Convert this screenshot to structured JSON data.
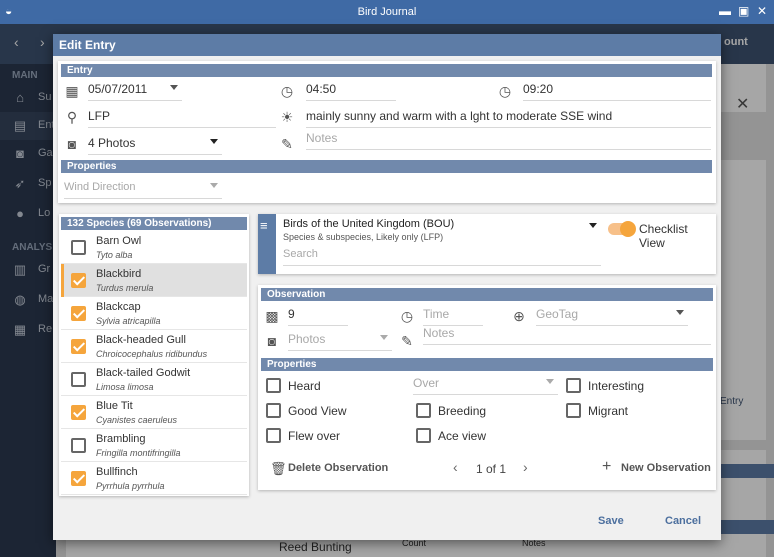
{
  "window": {
    "title": "Bird Journal"
  },
  "app": {
    "sidebar": {
      "main_heading": "MAIN",
      "items": [
        {
          "label": "Su",
          "icon": "home-icon"
        },
        {
          "label": "Ent",
          "icon": "journal-icon"
        },
        {
          "label": "Ga",
          "icon": "camera-icon"
        },
        {
          "label": "Sp",
          "icon": "bird-icon"
        },
        {
          "label": "Lo",
          "icon": "location-icon"
        }
      ],
      "analysis_heading": "ANALYS",
      "analysis_items": [
        {
          "label": "Gr",
          "icon": "chart-icon"
        },
        {
          "label": "Ma",
          "icon": "globe-icon"
        },
        {
          "label": "Re",
          "icon": "report-icon"
        }
      ]
    },
    "header_right": "ount",
    "entry_button": "Entry",
    "bg_row": {
      "name": "Reed Bunting",
      "count_label": "Count",
      "notes_label": "Notes"
    }
  },
  "dialog": {
    "title": "Edit Entry",
    "entry": {
      "heading": "Entry",
      "date": "05/07/2011",
      "start_time": "04:50",
      "end_time": "09:20",
      "location": "LFP",
      "weather": "mainly sunny and warm with a lght to moderate SSE wind",
      "photos": "4 Photos",
      "notes_placeholder": "Notes",
      "properties_heading": "Properties",
      "wind_placeholder": "Wind Direction"
    },
    "species": {
      "heading": "132 Species (69 Observations)",
      "items": [
        {
          "name": "Barn Owl",
          "latin": "Tyto alba",
          "checked": false
        },
        {
          "name": "Blackbird",
          "latin": "Turdus merula",
          "checked": true
        },
        {
          "name": "Blackcap",
          "latin": "Sylvia atricapilla",
          "checked": true
        },
        {
          "name": "Black-headed Gull",
          "latin": "Chroicocephalus ridibundus",
          "checked": true
        },
        {
          "name": "Black-tailed Godwit",
          "latin": "Limosa limosa",
          "checked": false
        },
        {
          "name": "Blue Tit",
          "latin": "Cyanistes caeruleus",
          "checked": true
        },
        {
          "name": "Brambling",
          "latin": "Fringilla montifringilla",
          "checked": false
        },
        {
          "name": "Bullfinch",
          "latin": "Pyrrhula pyrrhula",
          "checked": true
        }
      ]
    },
    "filter": {
      "list_name": "Birds of the United Kingdom (BOU)",
      "list_sub": "Species & subspecies, Likely only (LFP)",
      "search_placeholder": "Search",
      "checklist_label": "Checklist View"
    },
    "observation": {
      "heading": "Observation",
      "count": "9",
      "time_placeholder": "Time",
      "geotag_placeholder": "GeoTag",
      "photos_placeholder": "Photos",
      "notes_placeholder": "Notes",
      "properties_heading": "Properties",
      "over_placeholder": "Over",
      "checks": {
        "heard": "Heard",
        "interesting": "Interesting",
        "good_view": "Good View",
        "breeding": "Breeding",
        "migrant": "Migrant",
        "flew_over": "Flew over",
        "ace_view": "Ace view"
      },
      "delete_label": "Delete Observation",
      "pager": "1 of 1",
      "new_label": "New Observation"
    },
    "save_label": "Save",
    "cancel_label": "Cancel"
  },
  "colors": {
    "accent": "#f5a53c",
    "header": "#5d7ca6",
    "section": "#7189ac"
  }
}
